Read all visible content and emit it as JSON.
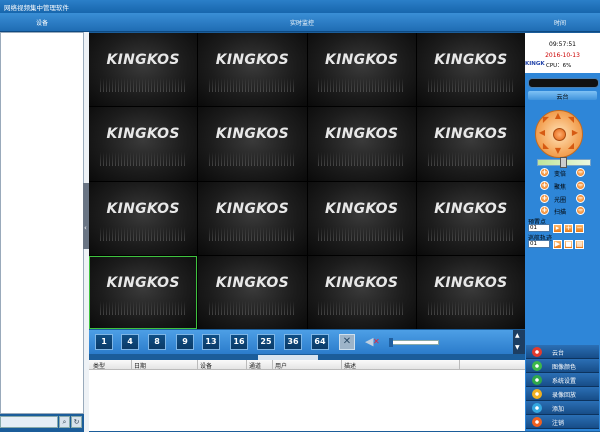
{
  "window": {
    "title": "网络视频集中管理软件"
  },
  "header": {
    "device_tab": "设备",
    "monitor_tab": "实时监控",
    "time_tab": "时间"
  },
  "video": {
    "brand": "KINGKOS",
    "selected_index": 12
  },
  "split_buttons": [
    "1",
    "4",
    "8",
    "9",
    "13",
    "16",
    "25",
    "36",
    "64"
  ],
  "log": {
    "columns": [
      "类型",
      "日期",
      "设备",
      "通道",
      "用户",
      "描述"
    ]
  },
  "clock": {
    "time": "09:57:51",
    "date": "2016-10-13",
    "brand": "KINGK",
    "cpu": "CPU：6%"
  },
  "ptz": {
    "title": "云台",
    "controls": [
      "变倍",
      "聚焦",
      "光圈",
      "扫描"
    ],
    "preset_label": "预置点",
    "preset_value": "01",
    "cruise_label": "巡航轨迹",
    "cruise_value": "01"
  },
  "menu": [
    {
      "label": "云台",
      "icon": "ptz-icon",
      "color": "#e23b2e"
    },
    {
      "label": "图像颜色",
      "icon": "palette-icon",
      "color": "#3cb84a"
    },
    {
      "label": "系统设置",
      "icon": "settings-icon",
      "color": "#2fa84a"
    },
    {
      "label": "录像回放",
      "icon": "playback-icon",
      "color": "#f0b020"
    },
    {
      "label": "添加",
      "icon": "add-icon",
      "color": "#34a8e0"
    },
    {
      "label": "注销",
      "icon": "logout-icon",
      "color": "#f06020"
    }
  ]
}
